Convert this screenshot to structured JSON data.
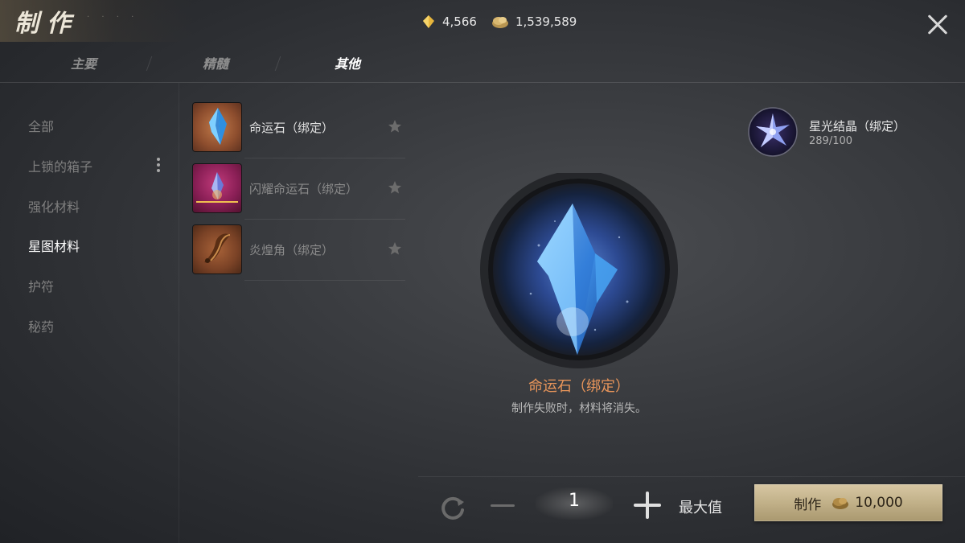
{
  "header": {
    "title": "制作",
    "currencies": [
      {
        "icon": "crystal-currency-icon",
        "value": "4,566"
      },
      {
        "icon": "gold-coin-icon",
        "value": "1,539,589"
      }
    ],
    "tabs": [
      {
        "label": "主要",
        "active": false
      },
      {
        "label": "精髓",
        "active": false
      },
      {
        "label": "其他",
        "active": true
      }
    ]
  },
  "sidebar": {
    "categories": [
      {
        "label": "全部",
        "active": false
      },
      {
        "label": "上锁的箱子",
        "active": false
      },
      {
        "label": "强化材料",
        "active": false
      },
      {
        "label": "星图材料",
        "active": true
      },
      {
        "label": "护符",
        "active": false
      },
      {
        "label": "秘药",
        "active": false
      }
    ]
  },
  "items": [
    {
      "name": "命运石（绑定）",
      "icon": "fate-stone-icon",
      "selected": true
    },
    {
      "name": "闪耀命运石（绑定）",
      "icon": "shining-fate-stone-icon",
      "selected": false
    },
    {
      "name": "炎煌角（绑定）",
      "icon": "flame-horn-icon",
      "selected": false
    }
  ],
  "material": {
    "name": "星光结晶（绑定）",
    "count": "289/100",
    "icon": "starlight-crystal-icon"
  },
  "detail": {
    "name": "命运石（绑定）",
    "description": "制作失败时，材料将消失。"
  },
  "controls": {
    "quantity": "1",
    "max_label": "最大值",
    "craft_label": "制作",
    "craft_cost": "10,000"
  },
  "colors": {
    "accent_orange": "#e8955a",
    "button_gold": "#c9b88f"
  }
}
